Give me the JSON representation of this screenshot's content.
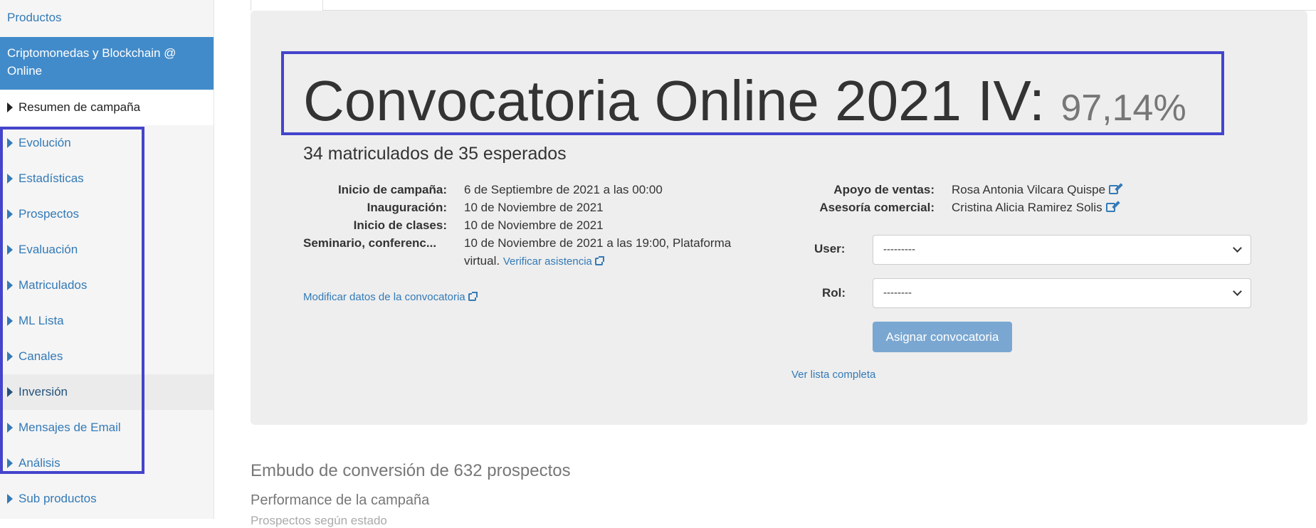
{
  "sidebar": {
    "top_link": "Productos",
    "active_product": "Criptomonedas y Blockchain @ Online",
    "current": "Resumen de campaña",
    "items": [
      "Evolución",
      "Estadísticas",
      "Prospectos",
      "Evaluación",
      "Matriculados",
      "ML Lista",
      "Canales",
      "Inversión",
      "Mensajes de Email",
      "Análisis",
      "Sub productos"
    ]
  },
  "campaign": {
    "title": "Convocatoria Online 2021 IV:",
    "percent": "97,14%",
    "enrolled_summary": "34 matriculados de 35 esperados",
    "details": [
      {
        "label": "Inicio de campaña:",
        "value": "6 de Septiembre de 2021 a las 00:00"
      },
      {
        "label": "Inauguración:",
        "value": "10 de Noviembre de 2021"
      },
      {
        "label": "Inicio de clases:",
        "value": "10 de Noviembre de 2021"
      },
      {
        "label": "Seminario, conferenc...",
        "value": "10 de Noviembre de 2021 a las 19:00, Plataforma",
        "value2": "virtual.",
        "link": "Verificar asistencia"
      }
    ],
    "modify_link": "Modificar datos de la convocatoria",
    "support": [
      {
        "label": "Apoyo de ventas:",
        "value": "Rosa Antonia Vilcara Quispe"
      },
      {
        "label": "Asesoría comercial:",
        "value": "Cristina Alicia Ramirez Solis"
      }
    ]
  },
  "form": {
    "user_label": "User:",
    "user_value": "---------",
    "rol_label": "Rol:",
    "rol_value": "--------",
    "assign_button": "Asignar convocatoria",
    "full_list_link": "Ver lista completa"
  },
  "sections": {
    "funnel": "Embudo de conversión de 632 prospectos",
    "performance": "Performance de la campaña",
    "by_state": "Prospectos según estado"
  }
}
